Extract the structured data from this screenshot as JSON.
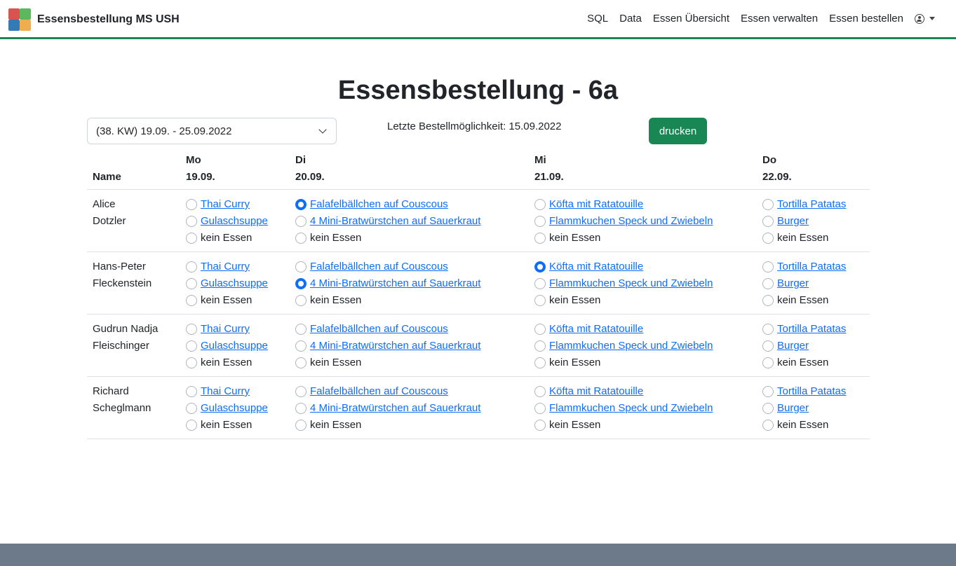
{
  "nav": {
    "brand": "Essensbestellung MS USH",
    "links": [
      "SQL",
      "Data",
      "Essen Übersicht",
      "Essen verwalten",
      "Essen bestellen"
    ]
  },
  "page": {
    "title": "Essensbestellung - 6a",
    "week_select": "(38. KW) 19.09. - 25.09.2022",
    "deadline": "Letzte Bestellmöglichkeit: 15.09.2022",
    "print_label": "drucken"
  },
  "table": {
    "name_header": "Name",
    "days": [
      {
        "day": "Mo",
        "date": "19.09."
      },
      {
        "day": "Di",
        "date": "20.09."
      },
      {
        "day": "Mi",
        "date": "21.09."
      },
      {
        "day": "Do",
        "date": "22.09."
      }
    ],
    "menus": [
      [
        "Thai Curry",
        "Gulaschsuppe",
        "kein Essen"
      ],
      [
        "Falafelbällchen auf Couscous",
        "4 Mini-Bratwürstchen auf Sauerkraut",
        "kein Essen"
      ],
      [
        "Köfta mit Ratatouille",
        "Flammkuchen Speck und Zwiebeln",
        "kein Essen"
      ],
      [
        "Tortilla Patatas",
        "Burger",
        "kein Essen"
      ]
    ],
    "rows": [
      {
        "first": "Alice",
        "last": "Dotzler",
        "selected": [
          null,
          0,
          null,
          null
        ]
      },
      {
        "first": "Hans-Peter",
        "last": "Fleckenstein",
        "selected": [
          null,
          1,
          0,
          null
        ]
      },
      {
        "first": "Gudrun Nadja",
        "last": "Fleischinger",
        "selected": [
          null,
          null,
          null,
          null
        ]
      },
      {
        "first": "Richard",
        "last": "Scheglmann",
        "selected": [
          null,
          null,
          null,
          null
        ]
      }
    ]
  },
  "colors": {
    "accent": "#198754",
    "link": "#0d6efd",
    "footer": "#6c7a89"
  }
}
